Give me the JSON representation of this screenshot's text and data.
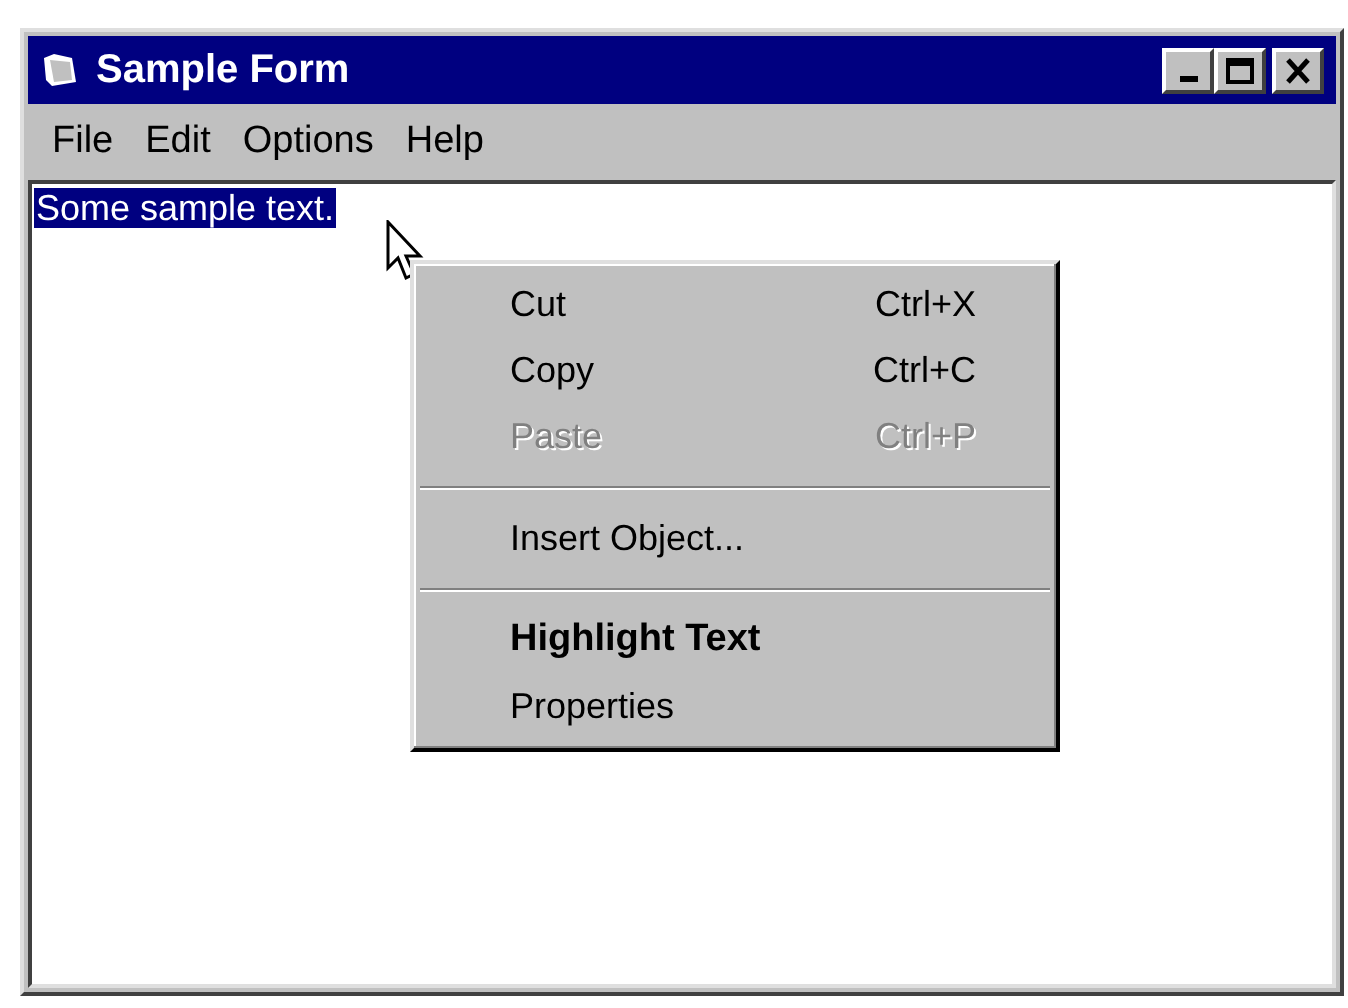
{
  "window": {
    "title": "Sample Form"
  },
  "menu_bar": [
    {
      "label": "File"
    },
    {
      "label": "Edit"
    },
    {
      "label": "Options"
    },
    {
      "label": "Help"
    }
  ],
  "document": {
    "text": "Some sample text.",
    "selected": true
  },
  "context_menu": [
    {
      "kind": "item",
      "label": "Cut",
      "shortcut": "Ctrl+X",
      "disabled": false,
      "default": false
    },
    {
      "kind": "item",
      "label": "Copy",
      "shortcut": "Ctrl+C",
      "disabled": false,
      "default": false
    },
    {
      "kind": "item",
      "label": "Paste",
      "shortcut": "Ctrl+P",
      "disabled": true,
      "default": false
    },
    {
      "kind": "separator"
    },
    {
      "kind": "item",
      "label": "Insert Object...",
      "disabled": false,
      "default": false
    },
    {
      "kind": "separator"
    },
    {
      "kind": "item",
      "label": "Highlight Text",
      "disabled": false,
      "default": true
    },
    {
      "kind": "item",
      "label": "Properties",
      "disabled": false,
      "default": false
    }
  ]
}
